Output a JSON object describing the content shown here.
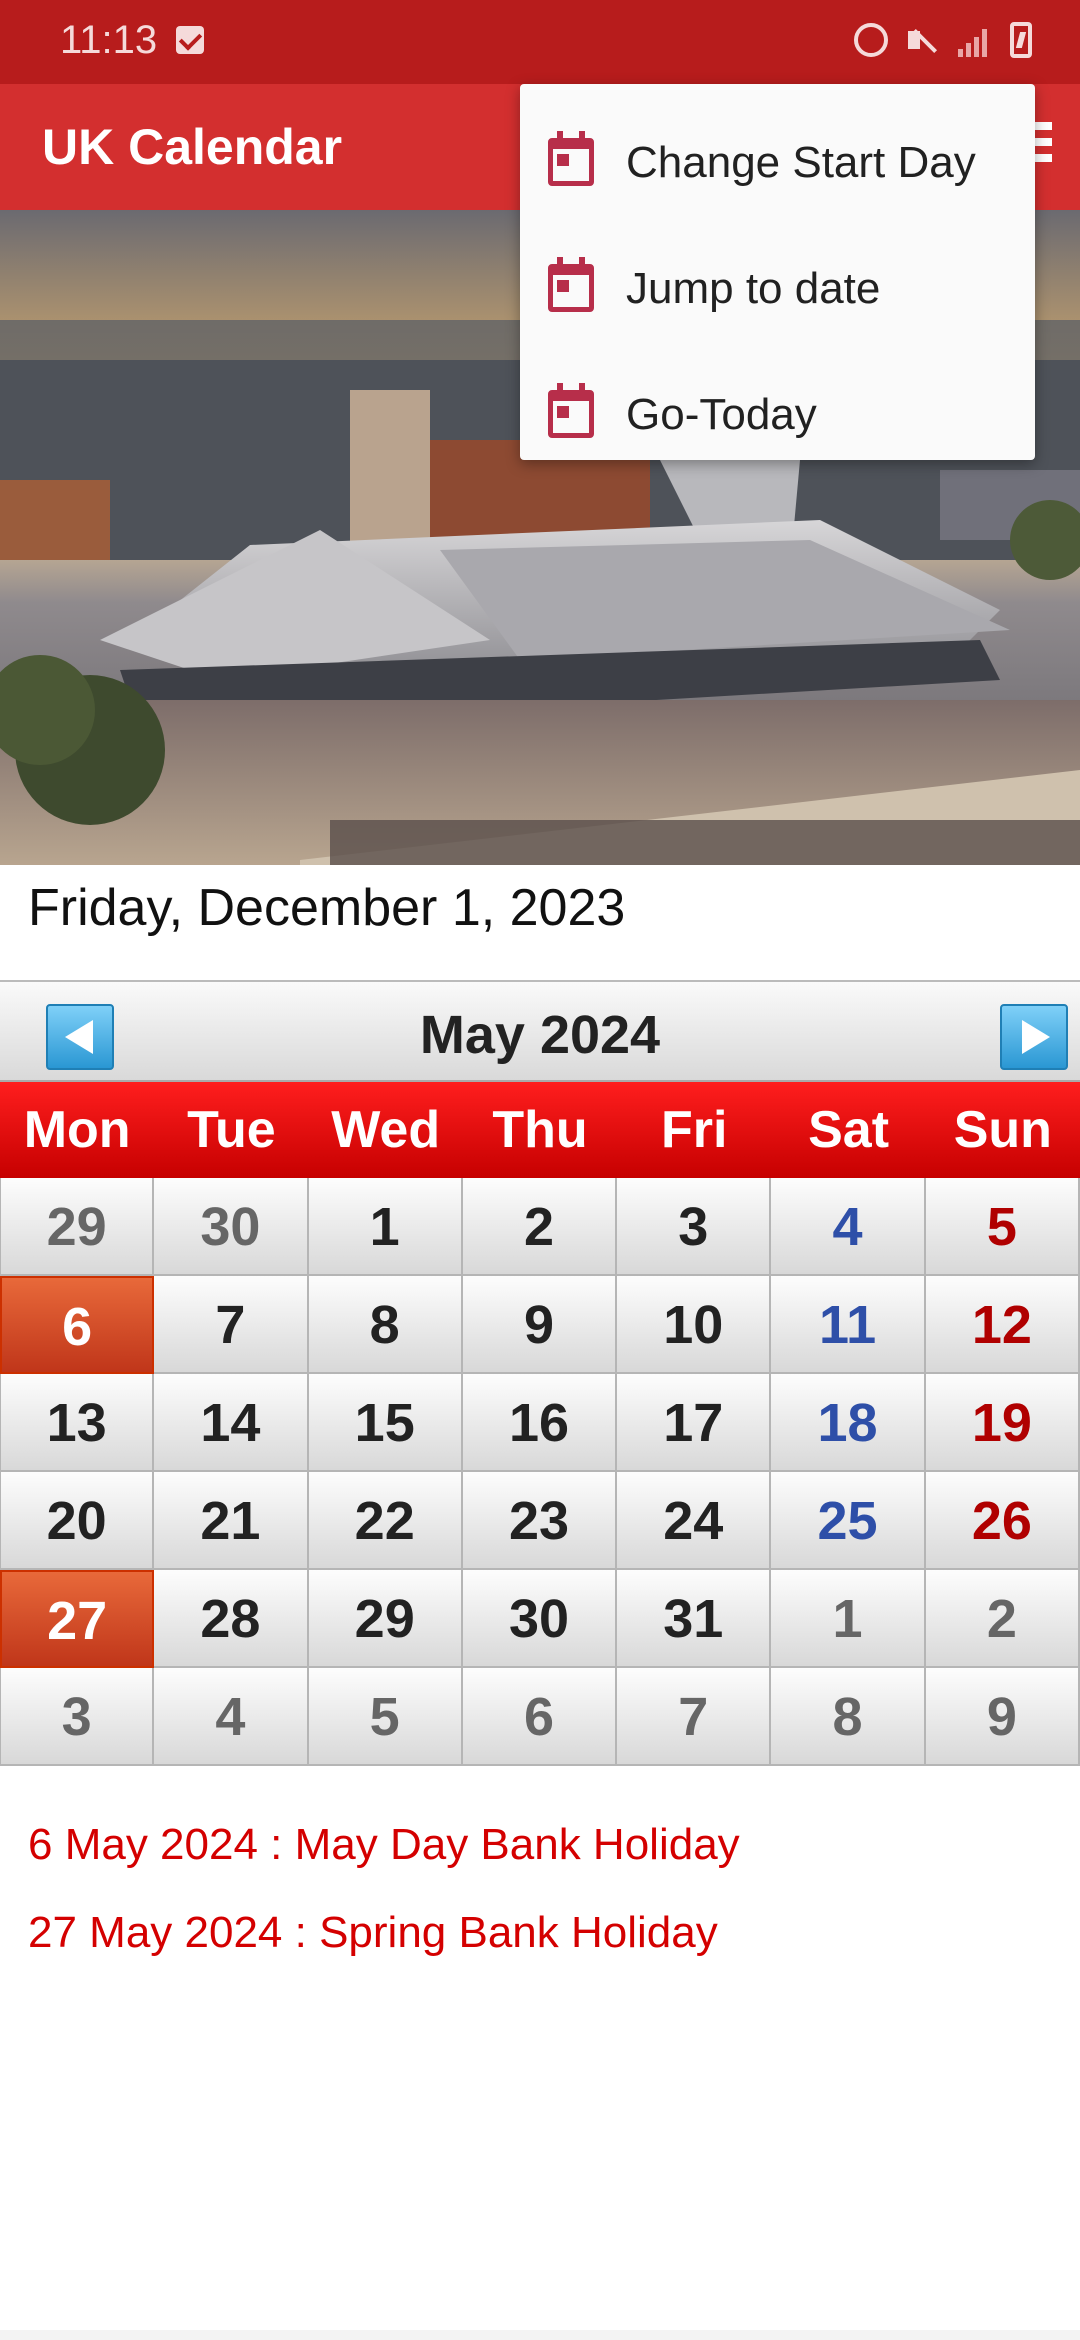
{
  "status_bar": {
    "time": "11:13"
  },
  "app_bar": {
    "title": "UK Calendar"
  },
  "current_date": "Friday, December 1, 2023",
  "calendar": {
    "title": "May  2024",
    "weekdays": [
      "Mon",
      "Tue",
      "Wed",
      "Thu",
      "Fri",
      "Sat",
      "Sun"
    ],
    "weeks": [
      [
        "29",
        "30",
        "1",
        "2",
        "3",
        "4",
        "5"
      ],
      [
        "6",
        "7",
        "8",
        "9",
        "10",
        "11",
        "12"
      ],
      [
        "13",
        "14",
        "15",
        "16",
        "17",
        "18",
        "19"
      ],
      [
        "20",
        "21",
        "22",
        "23",
        "24",
        "25",
        "26"
      ],
      [
        "27",
        "28",
        "29",
        "30",
        "31",
        "1",
        "2"
      ],
      [
        "3",
        "4",
        "5",
        "6",
        "7",
        "8",
        "9"
      ]
    ]
  },
  "holidays": [
    "6 May 2024 : May Day Bank Holiday",
    "27 May 2024 : Spring Bank Holiday"
  ],
  "menu": {
    "items": [
      {
        "label": "Change Start Day",
        "icon": "calendar-icon"
      },
      {
        "label": "Jump to date",
        "icon": "calendar-icon"
      },
      {
        "label": "Go-Today",
        "icon": "calendar-icon"
      }
    ]
  },
  "colors": {
    "status_bar": "#b71c1c",
    "app_bar": "#d32f2f",
    "weekday_header": "#e00000",
    "holiday_cell": "#d9502a",
    "saturday": "#2e4fa8",
    "sunday": "#b00000",
    "holiday_text": "#d40000"
  }
}
